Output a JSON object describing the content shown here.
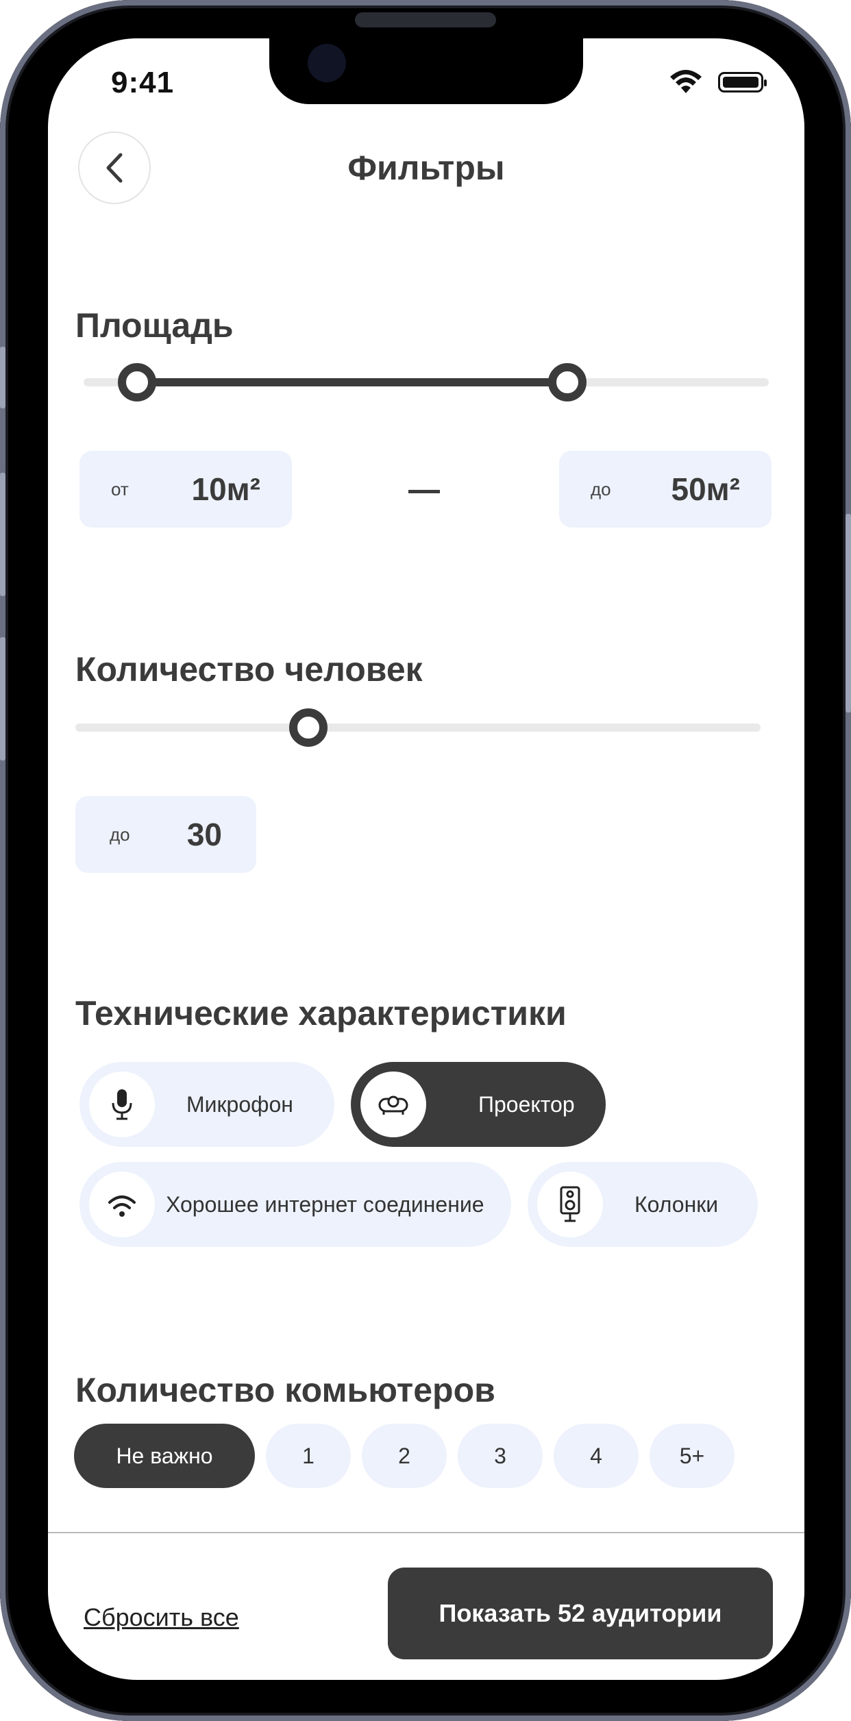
{
  "status_bar": {
    "time": "9:41",
    "wifi_icon": "wifi-icon",
    "battery_icon": "battery-icon"
  },
  "header": {
    "title": "Фильтры",
    "back_icon": "chevron-left-icon"
  },
  "area": {
    "title": "Площадь",
    "range_min_value": 10,
    "range_max_value": 50,
    "from": {
      "label": "от",
      "value": "10м²"
    },
    "to": {
      "label": "до",
      "value": "50м²"
    }
  },
  "people": {
    "title": "Количество человек",
    "slider_value": 30,
    "to": {
      "label": "до",
      "value": "30"
    }
  },
  "tech": {
    "title": "Технические характеристики",
    "chips": [
      {
        "label": "Микрофон",
        "icon": "microphone-icon",
        "selected": false
      },
      {
        "label": "Проектор",
        "icon": "projector-icon",
        "selected": true
      },
      {
        "label": "Хорошее интернет соединение",
        "icon": "wifi-icon",
        "selected": false
      },
      {
        "label": "Колонки",
        "icon": "speaker-icon",
        "selected": false
      }
    ]
  },
  "computers": {
    "title": "Количество комьютеров",
    "options": [
      "Не важно",
      "1",
      "2",
      "3",
      "4",
      "5+"
    ],
    "selected": "Не важно"
  },
  "footer": {
    "reset_label": "Сбросить все",
    "show_label": "Показать 52 аудитории"
  },
  "colors": {
    "accent_dark": "#3b3b3b",
    "chip_bg": "#edf2fc",
    "track": "#e9e9e9"
  }
}
